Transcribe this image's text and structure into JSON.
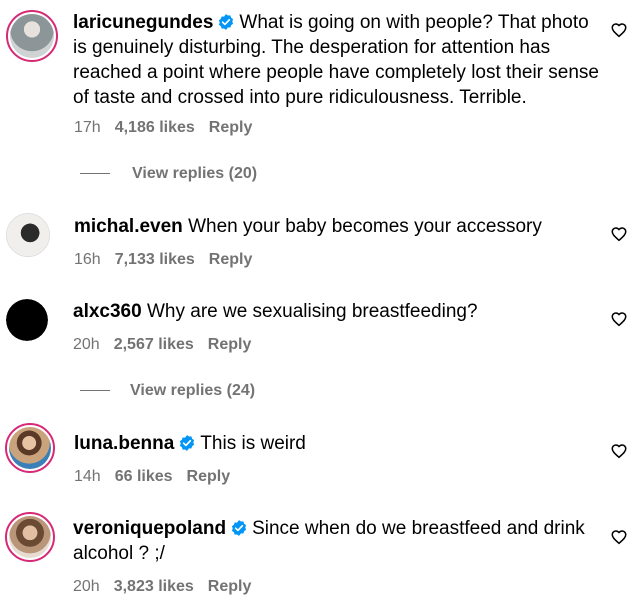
{
  "comments": [
    {
      "username": "laricunegundes",
      "verified": true,
      "text": "What is going on with people? That photo is genuinely disturbing. The desperation for attention has reached a point where people have completely lost their sense of taste and crossed into pure ridiculousness. Terrible.",
      "time": "17h",
      "likes": "4,186 likes",
      "reply": "Reply",
      "view_replies": "View replies (20)",
      "avatar_color": "#9aa3a6"
    },
    {
      "username": "michal.even",
      "verified": false,
      "text": "When your baby becomes your accessory",
      "time": "16h",
      "likes": "7,133 likes",
      "reply": "Reply",
      "avatar_color": "#e9e6e2"
    },
    {
      "username": "alxc360",
      "verified": false,
      "text": "Why are we sexualising breastfeeding?",
      "time": "20h",
      "likes": "2,567 likes",
      "reply": "Reply",
      "view_replies": "View replies (24)",
      "avatar_color": "#000000"
    },
    {
      "username": "luna.benna",
      "verified": true,
      "text": "This is weird",
      "time": "14h",
      "likes": "66 likes",
      "reply": "Reply",
      "avatar_color": "#c8a27c"
    },
    {
      "username": "veroniquepoland",
      "verified": true,
      "text": "Since when do we breastfeed and drink alcohol ? ;/",
      "time": "20h",
      "likes": "3,823 likes",
      "reply": "Reply",
      "avatar_color": "#b58e6f"
    }
  ],
  "icons": {
    "verified": "verified-badge-icon",
    "like": "heart-icon"
  },
  "colors": {
    "verified_blue": "#0095f6",
    "meta_gray": "#737373",
    "ring": "#d62976"
  }
}
